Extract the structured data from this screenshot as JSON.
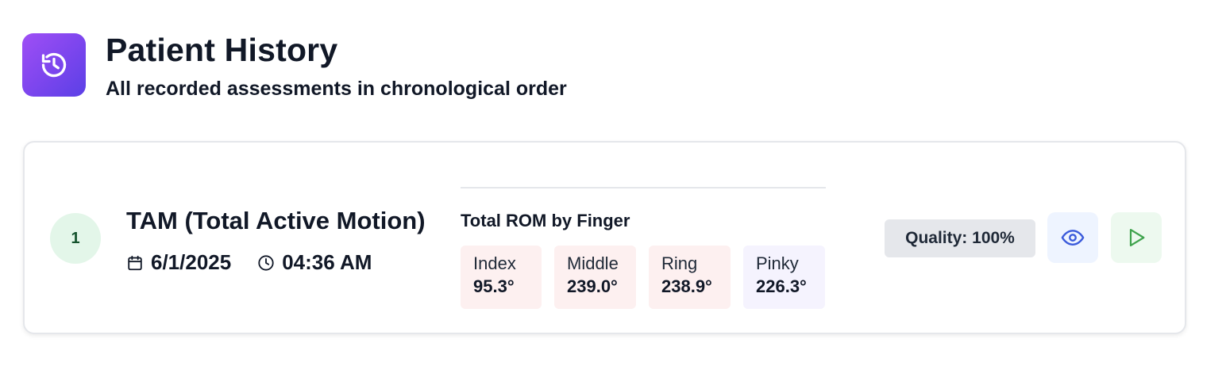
{
  "header": {
    "icon": "history-icon",
    "title": "Patient History",
    "subtitle": "All recorded assessments in chronological order"
  },
  "assessments": [
    {
      "index": "1",
      "name": "TAM (Total Active Motion)",
      "date": "6/1/2025",
      "time": "04:36 AM",
      "rom_title": "Total ROM by Finger",
      "fingers": [
        {
          "label": "Index",
          "value": "95.3°",
          "bg": "#fdf0f0"
        },
        {
          "label": "Middle",
          "value": "239.0°",
          "bg": "#fdf0f0"
        },
        {
          "label": "Ring",
          "value": "238.9°",
          "bg": "#fdf0f0"
        },
        {
          "label": "Pinky",
          "value": "226.3°",
          "bg": "#f5f3fe"
        }
      ],
      "quality": "Quality: 100%",
      "actions": {
        "view_icon": "eye-icon",
        "play_icon": "play-icon"
      }
    }
  ],
  "colors": {
    "accent_gradient_start": "#9f4ff5",
    "accent_gradient_end": "#5b40e6",
    "view_icon": "#3b5bdb",
    "play_icon": "#3fa34d",
    "index_badge_bg": "#e3f6e9"
  }
}
